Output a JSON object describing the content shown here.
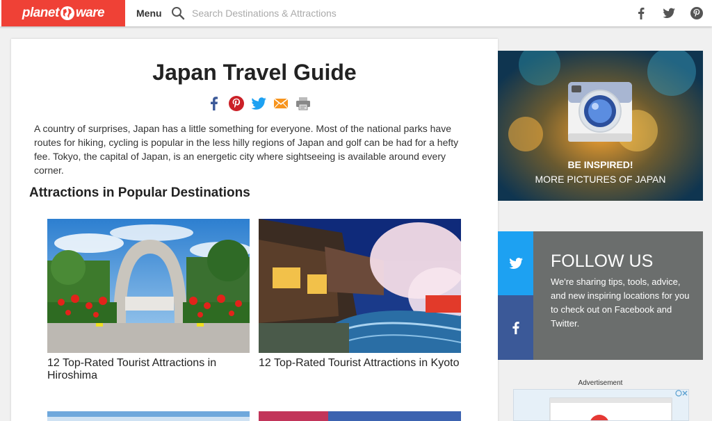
{
  "header": {
    "logo_left": "planet",
    "logo_right": "ware",
    "menu_label": "Menu",
    "search_placeholder": "Search Destinations & Attractions",
    "social": [
      "facebook-icon",
      "twitter-icon",
      "pinterest-icon"
    ]
  },
  "article": {
    "title": "Japan Travel Guide",
    "share_icons": [
      "facebook-icon",
      "pinterest-icon",
      "twitter-icon",
      "email-icon",
      "print-icon"
    ],
    "intro": "A country of surprises, Japan has a little something for everyone. Most of the national parks have routes for hiking, cycling is popular in the less hilly regions of Japan and golf can be had for a hefty fee. Tokyo, the capital of Japan, is an energetic city where sightseeing is available around every corner.",
    "section_title": "Attractions in Popular Destinations",
    "cards": [
      {
        "caption": "12 Top-Rated Tourist Attractions in Hiroshima"
      },
      {
        "caption": "12 Top-Rated Tourist Attractions in Kyoto"
      }
    ]
  },
  "sidebar": {
    "inspire_title": "BE INSPIRED!",
    "inspire_sub": "MORE PICTURES OF JAPAN",
    "follow_title": "FOLLOW US",
    "follow_text": "We're sharing tips, tools, advice, and new inspiring locations for you to check out on Facebook and Twitter.",
    "ad_label": "Advertisement"
  },
  "colors": {
    "brand": "#ef4136",
    "twitter": "#1da1f2",
    "facebook": "#3b5998",
    "follow_bg": "#6b6e6d"
  }
}
